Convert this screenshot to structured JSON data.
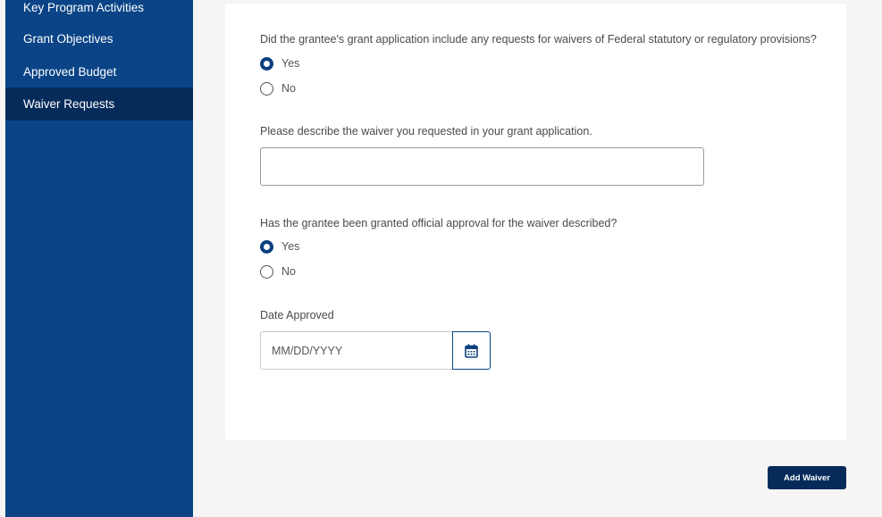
{
  "sidebar": {
    "items": [
      {
        "label": "Key Program Activities"
      },
      {
        "label": "Grant Objectives"
      },
      {
        "label": "Approved Budget"
      },
      {
        "label": "Waiver Requests"
      }
    ]
  },
  "form": {
    "q1": {
      "label": "Did the grantee's grant application include any requests for waivers of Federal statutory or regulatory provisions?",
      "yes": "Yes",
      "no": "No",
      "selected": "Yes"
    },
    "q2": {
      "label": "Please describe the waiver you requested in your grant application.",
      "value": ""
    },
    "q3": {
      "label": "Has the grantee been granted official approval for the waiver described?",
      "yes": "Yes",
      "no": "No",
      "selected": "Yes"
    },
    "date": {
      "label": "Date Approved",
      "placeholder": "MM/DD/YYYY",
      "icon": "calendar-icon"
    }
  },
  "actions": {
    "add_waiver": "Add Waiver"
  },
  "colors": {
    "sidebar": "#0a4486",
    "sidebar_active": "#062b5a",
    "button": "#062b5a",
    "background": "#f5f5f5"
  }
}
